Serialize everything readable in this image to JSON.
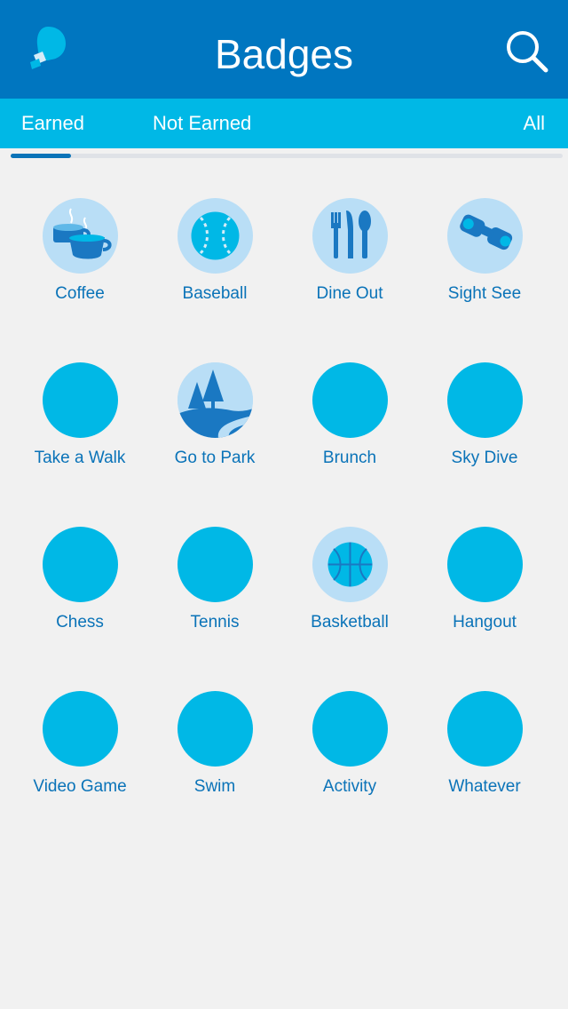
{
  "header": {
    "title": "Badges",
    "logo_icon": "chat-bubble-logo-icon",
    "search_icon": "search-icon"
  },
  "tabs": [
    {
      "label": "Earned",
      "selected": true
    },
    {
      "label": "Not Earned",
      "selected": false
    },
    {
      "label": "All",
      "selected": false
    }
  ],
  "progress": {
    "value": 0.11
  },
  "badges": [
    {
      "label": "Coffee",
      "earned": true,
      "icon": "coffee-icon"
    },
    {
      "label": "Baseball",
      "earned": true,
      "icon": "baseball-icon"
    },
    {
      "label": "Dine Out",
      "earned": true,
      "icon": "dine-out-icon"
    },
    {
      "label": "Sight See",
      "earned": true,
      "icon": "binoculars-icon"
    },
    {
      "label": "Take a Walk",
      "earned": false,
      "icon": ""
    },
    {
      "label": "Go to Park",
      "earned": true,
      "icon": "park-icon"
    },
    {
      "label": "Brunch",
      "earned": false,
      "icon": ""
    },
    {
      "label": "Sky Dive",
      "earned": false,
      "icon": ""
    },
    {
      "label": "Chess",
      "earned": false,
      "icon": ""
    },
    {
      "label": "Tennis",
      "earned": false,
      "icon": ""
    },
    {
      "label": "Basketball",
      "earned": true,
      "icon": "basketball-icon"
    },
    {
      "label": "Hangout",
      "earned": false,
      "icon": ""
    },
    {
      "label": "Video Game",
      "earned": false,
      "icon": ""
    },
    {
      "label": "Swim",
      "earned": false,
      "icon": ""
    },
    {
      "label": "Activity",
      "earned": false,
      "icon": ""
    },
    {
      "label": "Whatever",
      "earned": false,
      "icon": ""
    }
  ],
  "colors": {
    "header": "#0076c0",
    "tab_bar": "#00b8e6",
    "badge_locked": "#00b8e6",
    "badge_earned_bg": "#b9def6",
    "label": "#0a73b8",
    "background": "#f1f1f1"
  }
}
